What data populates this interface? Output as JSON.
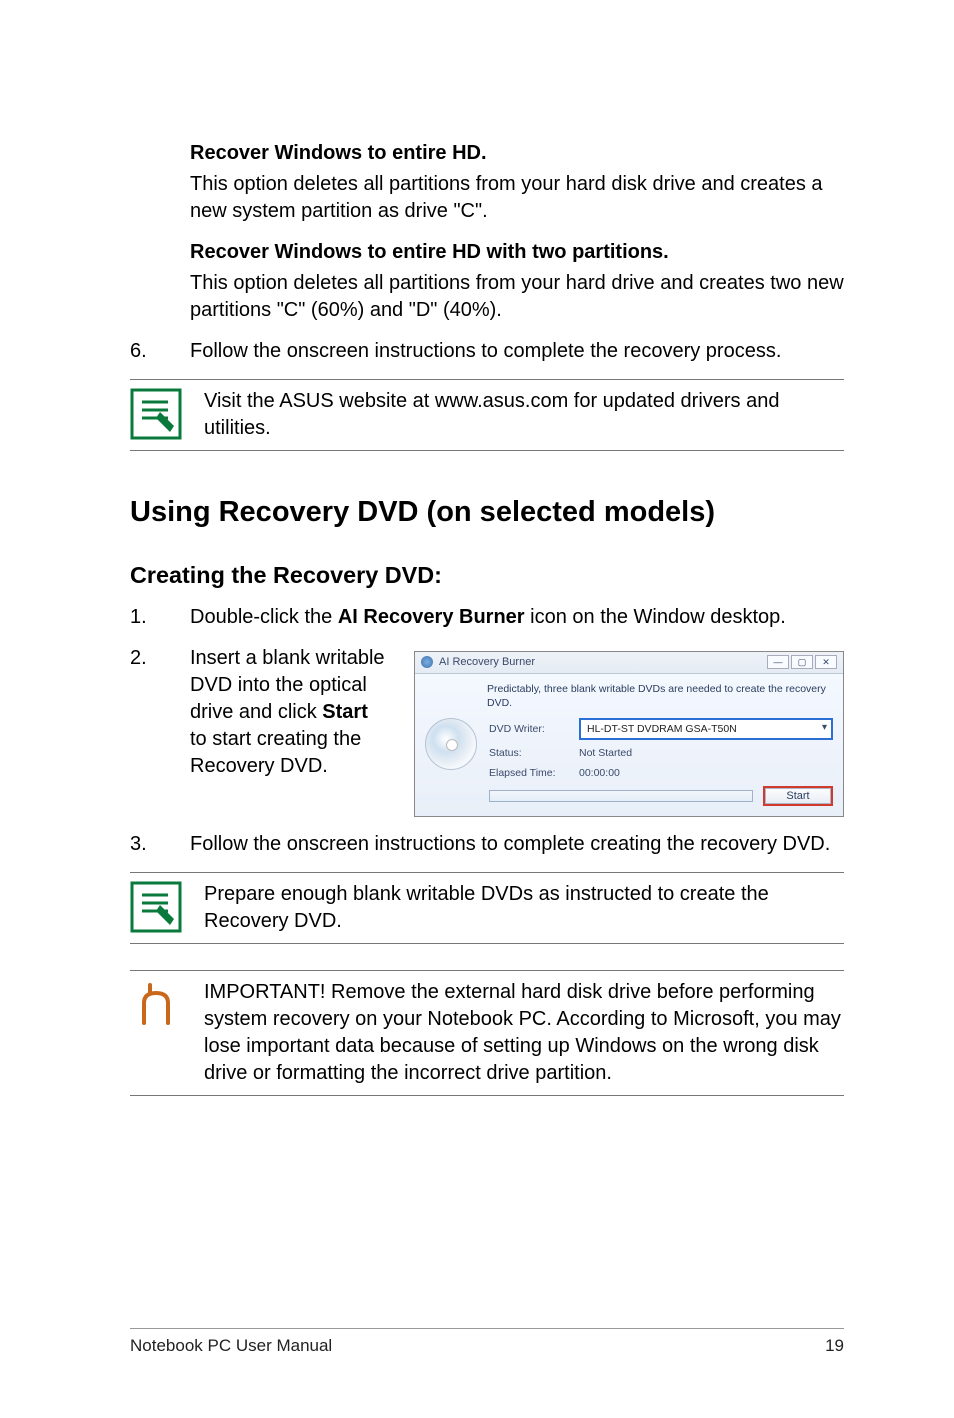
{
  "options": {
    "entire_hd": {
      "title": "Recover Windows to entire HD.",
      "desc": "This option deletes all partitions from your hard disk drive and creates a new system partition as drive \"C\"."
    },
    "entire_hd_two": {
      "title": "Recover Windows to entire HD with two partitions.",
      "desc": "This option deletes all partitions from your hard drive and creates two new partitions \"C\" (60%) and \"D\" (40%)."
    }
  },
  "step6": {
    "num": "6.",
    "text": "Follow the onscreen instructions to complete the recovery process."
  },
  "note1": "Visit the ASUS website at www.asus.com for updated drivers and utilities.",
  "heading": "Using Recovery DVD (on selected models)",
  "subheading": "Creating the Recovery DVD:",
  "step1": {
    "num": "1.",
    "prefix": "Double-click the ",
    "bold": "AI Recovery Burner",
    "suffix": " icon on the Window desktop."
  },
  "step2": {
    "num": "2.",
    "prefix": "Insert a blank writable DVD into the optical drive and click ",
    "bold": "Start",
    "suffix": " to start creating the Recovery DVD."
  },
  "dialog": {
    "title": "AI Recovery Burner",
    "msg": "Predictably, three blank writable DVDs are needed to create the recovery DVD.",
    "writer_lbl": "DVD Writer:",
    "writer_val": "HL-DT-ST DVDRAM GSA-T50N",
    "status_lbl": "Status:",
    "status_val": "Not Started",
    "elapsed_lbl": "Elapsed Time:",
    "elapsed_val": "00:00:00",
    "start_btn": "Start"
  },
  "step3": {
    "num": "3.",
    "text": "Follow the onscreen instructions to complete creating the recovery DVD."
  },
  "note2": "Prepare enough blank writable DVDs as instructed to create the Recovery DVD.",
  "important": "IMPORTANT! Remove the external hard disk drive before performing system recovery on your Notebook PC. According to Microsoft, you may lose important data because of setting up Windows on the wrong disk drive or formatting the incorrect drive partition.",
  "footer": {
    "left": "Notebook PC User Manual",
    "right": "19"
  }
}
